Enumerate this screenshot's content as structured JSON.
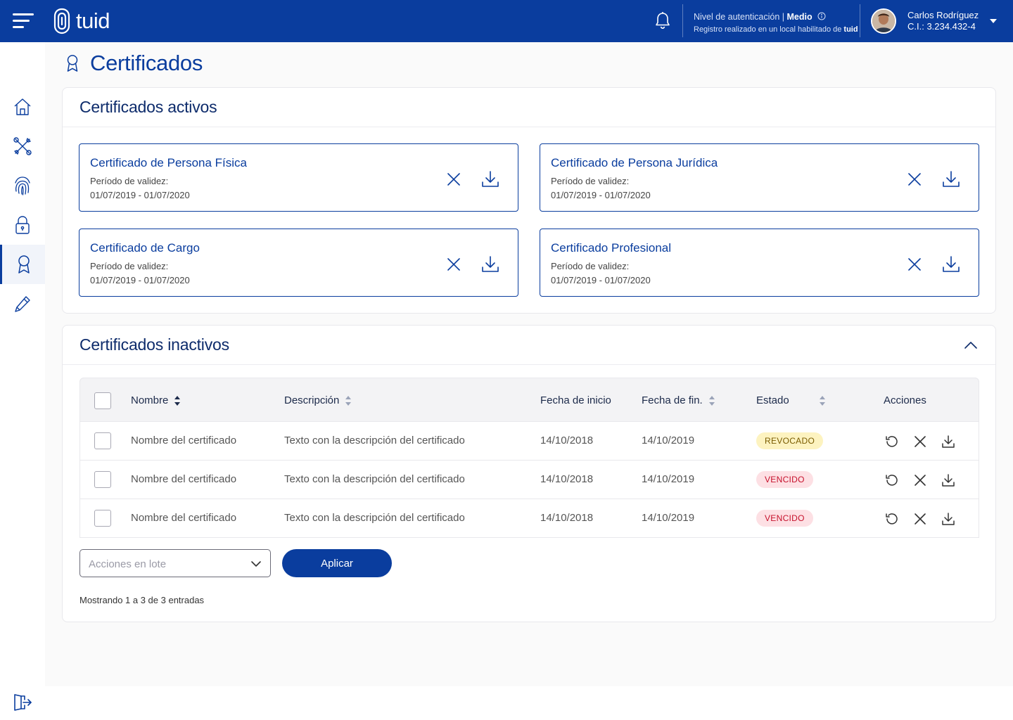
{
  "header": {
    "brand": "tuid",
    "auth_level_label": "Nivel de autenticación |",
    "auth_level_value": "Medio",
    "registry_text": "Registro realizado en un local habilitado de",
    "registry_brand": "tuid",
    "user_name": "Carlos Rodríguez",
    "user_id": "C.I.: 3.234.432-4"
  },
  "sidebar": {
    "items": [
      {
        "icon": "home-icon",
        "active": false
      },
      {
        "icon": "tools-icon",
        "active": false
      },
      {
        "icon": "fingerprint-icon",
        "active": false
      },
      {
        "icon": "lock-icon",
        "active": false
      },
      {
        "icon": "certificate-icon",
        "active": true
      },
      {
        "icon": "pen-icon",
        "active": false
      }
    ],
    "logout_icon": "logout-icon"
  },
  "page": {
    "title": "Certificados"
  },
  "active_section": {
    "title": "Certificados activos",
    "validity_label": "Período de validez:",
    "certificates": [
      {
        "title": "Certificado de Persona Física",
        "dates": "01/07/2019 - 01/07/2020"
      },
      {
        "title": "Certificado de Persona Jurídica",
        "dates": "01/07/2019 - 01/07/2020"
      },
      {
        "title": "Certificado de Cargo",
        "dates": "01/07/2019 - 01/07/2020"
      },
      {
        "title": "Certificado Profesional",
        "dates": "01/07/2019 - 01/07/2020"
      }
    ]
  },
  "inactive_section": {
    "title": "Certificados inactivos",
    "columns": {
      "name": "Nombre",
      "description": "Descripción",
      "start": "Fecha de inicio",
      "end": "Fecha de fin.",
      "status": "Estado",
      "actions": "Acciones"
    },
    "rows": [
      {
        "name": "Nombre del certificado",
        "description": "Texto con la descripción del certificado",
        "start": "14/10/2018",
        "end": "14/10/2019",
        "status": "REVOCADO"
      },
      {
        "name": "Nombre del certificado",
        "description": "Texto con la descripción del certificado",
        "start": "14/10/2018",
        "end": "14/10/2019",
        "status": "VENCIDO"
      },
      {
        "name": "Nombre del certificado",
        "description": "Texto con la descripción del certificado",
        "start": "14/10/2018",
        "end": "14/10/2019",
        "status": "VENCIDO"
      }
    ],
    "bulk_placeholder": "Acciones en lote",
    "apply_label": "Aplicar",
    "showing_text": "Mostrando 1 a 3 de 3 entradas"
  },
  "colors": {
    "primary": "#0a3d9e",
    "revocado_bg": "#fdf3c0",
    "vencido_bg": "#fde0e4",
    "vencido_text": "#c6102b"
  }
}
